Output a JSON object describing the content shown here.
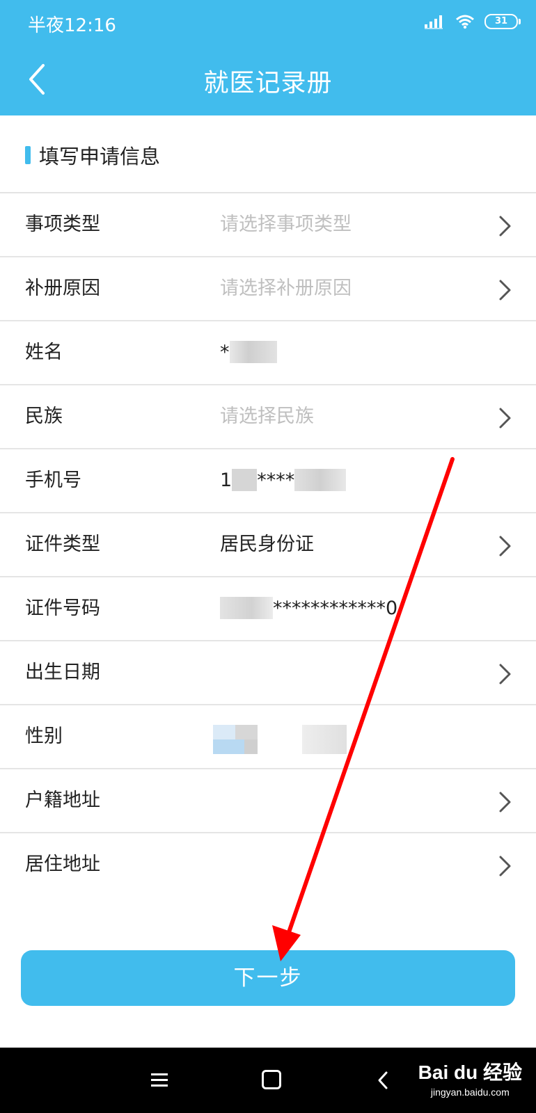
{
  "status_bar": {
    "time": "半夜12:16",
    "battery": "31"
  },
  "header": {
    "title": "就医记录册"
  },
  "section": {
    "title": "填写申请信息"
  },
  "form": {
    "rows": [
      {
        "label": "事项类型",
        "value": "",
        "placeholder": "请选择事项类型",
        "chevron": true
      },
      {
        "label": "补册原因",
        "value": "",
        "placeholder": "请选择补册原因",
        "chevron": true
      },
      {
        "label": "姓名",
        "value": "*",
        "placeholder": "",
        "chevron": false
      },
      {
        "label": "民族",
        "value": "",
        "placeholder": "请选择民族",
        "chevron": true
      },
      {
        "label": "手机号",
        "value_prefix": "1",
        "value_mid": "****",
        "chevron": false
      },
      {
        "label": "证件类型",
        "value": "居民身份证",
        "placeholder": "",
        "chevron": true
      },
      {
        "label": "证件号码",
        "value": "************0",
        "chevron": false
      },
      {
        "label": "出生日期",
        "value": "",
        "placeholder": "",
        "chevron": true
      },
      {
        "label": "性别",
        "value": "",
        "chevron": false
      },
      {
        "label": "户籍地址",
        "value": "",
        "placeholder": "",
        "chevron": true
      },
      {
        "label": "居住地址",
        "value": "",
        "placeholder": "",
        "chevron": true
      }
    ]
  },
  "actions": {
    "next_label": "下一步"
  },
  "watermark": {
    "logo": "Bai du 经验",
    "sub": "jingyan.baidu.com"
  },
  "colors": {
    "accent": "#41bced",
    "annotation": "#ff0000"
  }
}
